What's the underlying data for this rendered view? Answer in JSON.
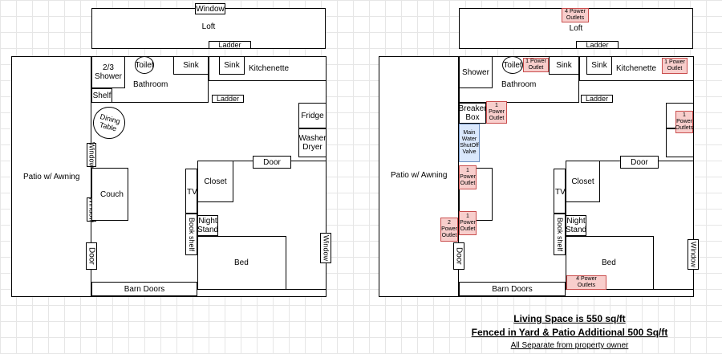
{
  "left_plan": {
    "loft": "Loft",
    "loft_window": "Window",
    "loft_ladder": "Ladder",
    "shower": "2/3\nShower",
    "toilet": "Toilet",
    "bathroom": "Bathroom",
    "sink_bath": "Sink",
    "sink_kitchen": "Sink",
    "kitchenette": "Kitchenette",
    "shelf": "Shelf",
    "ladder": "Ladder",
    "dining_table": "Dining\nTable",
    "fridge": "Fridge",
    "washer_dryer": "Washer\nDryer",
    "window_1": "Window",
    "window_2": "Window",
    "patio": "Patio w/ Awning",
    "couch": "Couch",
    "door_top": "Door",
    "tv": "TV",
    "closet": "Closet",
    "bookshelf": "Book shelf",
    "night_stand": "Night\nStand",
    "window_right": "Window",
    "door_left": "Door",
    "bed": "Bed",
    "barn_doors": "Barn Doors"
  },
  "right_plan": {
    "loft": "Loft",
    "loft_outlets": "4 Power\nOutlets",
    "loft_ladder": "Ladder",
    "shower": "Shower",
    "toilet": "Toilet",
    "bathroom": "Bathroom",
    "bath_outlet": "1 Power\nOutlet",
    "sink_bath": "Sink",
    "sink_kitchen": "Sink",
    "kitchenette": "Kitchenette",
    "kitchen_outlet": "1 Power\nOutlet",
    "ladder": "Ladder",
    "breaker_box": "Breaker\nBox",
    "breaker_outlet": "1\nPower\nOutlet",
    "water_valve": "Main\nWater\nShutOff\nValve",
    "fridge_outlet": "1\nPower\nOutlets",
    "patio": "Patio w/ Awning",
    "patio_outlet_1": "1\nPower\nOutlet",
    "patio_outlet_2": "1\nPower\nOutlet",
    "patio_outlet_3": "2\nPower\nOutlet",
    "door_top": "Door",
    "tv": "TV",
    "closet": "Closet",
    "bookshelf": "Book shelf",
    "night_stand": "Night\nStand",
    "window_right": "Window",
    "door_left": "Door",
    "bed": "Bed",
    "bed_outlets": "4 Power\nOutlets",
    "barn_doors": "Barn Doors"
  },
  "footer": {
    "line1": "Living Space is 550 sq/ft",
    "line2": "Fenced in Yard & Patio Additional 500 Sq/ft",
    "line3": "All Separate from property owner"
  }
}
